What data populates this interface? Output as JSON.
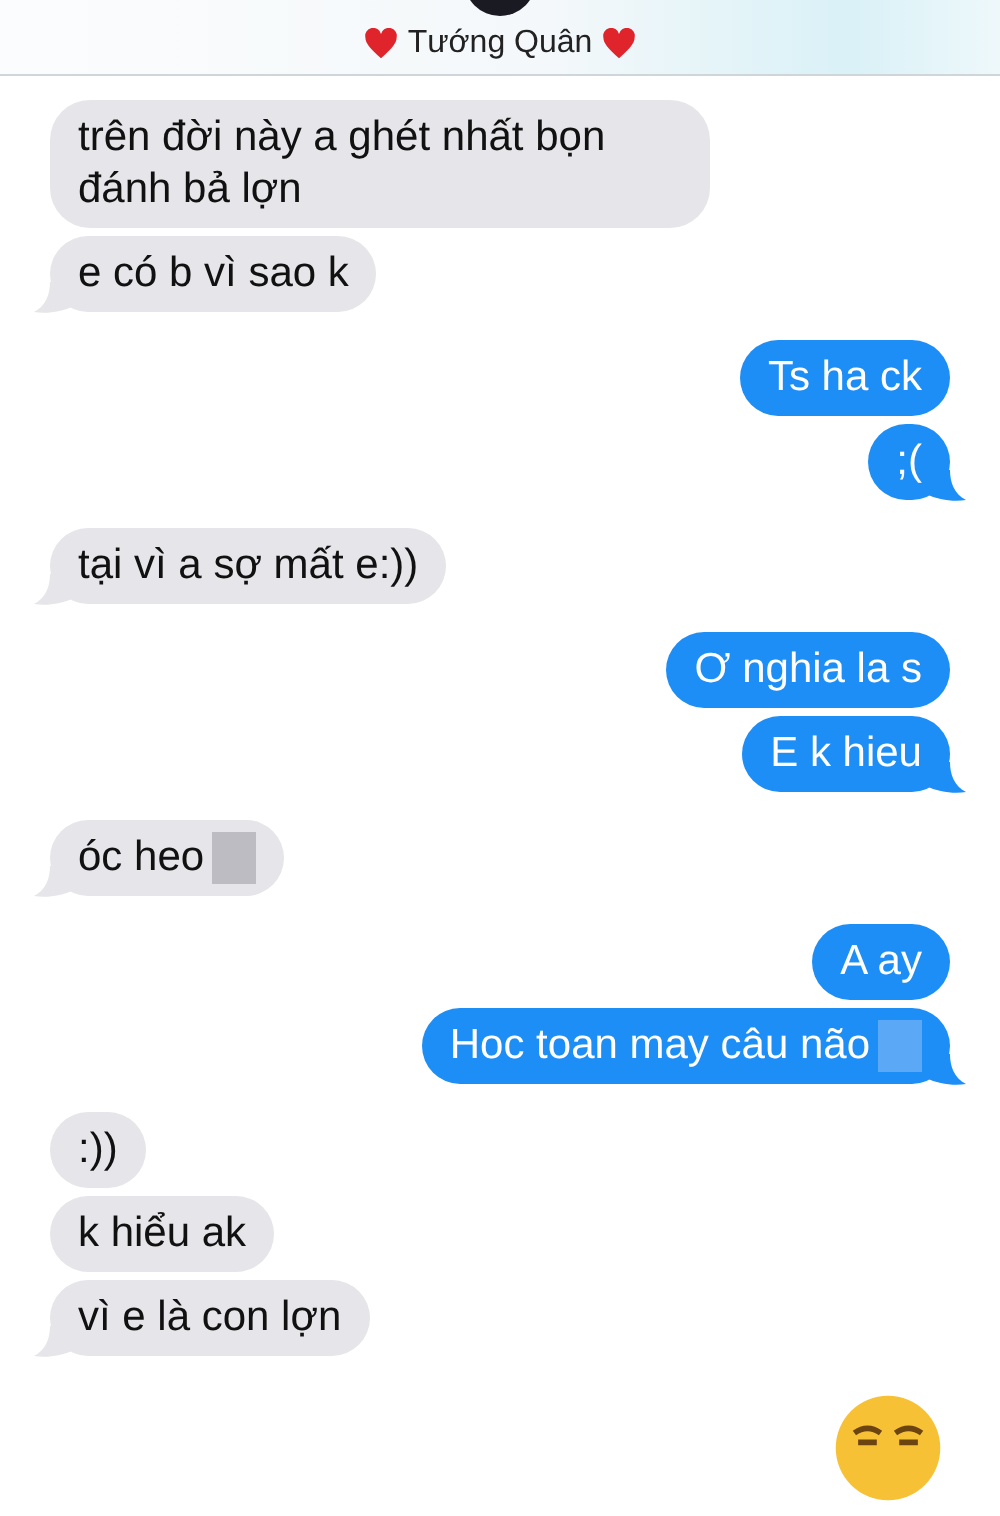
{
  "header": {
    "contact_name": "Tướng Quân"
  },
  "messages": [
    {
      "kind": "received",
      "text": "trên đời này a ghét nhất bọn đánh bả lợn",
      "tail": false,
      "placeholder_glyph": false
    },
    {
      "kind": "received",
      "text": "e có b vì sao k",
      "tail": true,
      "placeholder_glyph": false
    },
    {
      "kind": "sent",
      "text": "Ts ha ck",
      "tail": false,
      "placeholder_glyph": false
    },
    {
      "kind": "sent",
      "text": ";(",
      "tail": true,
      "placeholder_glyph": false
    },
    {
      "kind": "received",
      "text": "tại vì a sợ mất e:))",
      "tail": true,
      "placeholder_glyph": false
    },
    {
      "kind": "sent",
      "text": "Ơ nghia la s",
      "tail": false,
      "placeholder_glyph": false
    },
    {
      "kind": "sent",
      "text": "E k hieu",
      "tail": true,
      "placeholder_glyph": false
    },
    {
      "kind": "received",
      "text": "óc heo",
      "tail": true,
      "placeholder_glyph": true
    },
    {
      "kind": "sent",
      "text": "A ay",
      "tail": false,
      "placeholder_glyph": false
    },
    {
      "kind": "sent",
      "text": "Hoc toan may câu não",
      "tail": true,
      "placeholder_glyph": true
    },
    {
      "kind": "received",
      "text": ":))",
      "tail": false,
      "placeholder_glyph": false
    },
    {
      "kind": "received",
      "text": "k hiểu ak",
      "tail": false,
      "placeholder_glyph": false
    },
    {
      "kind": "received",
      "text": "vì e là con lợn",
      "tail": true,
      "placeholder_glyph": false
    }
  ]
}
